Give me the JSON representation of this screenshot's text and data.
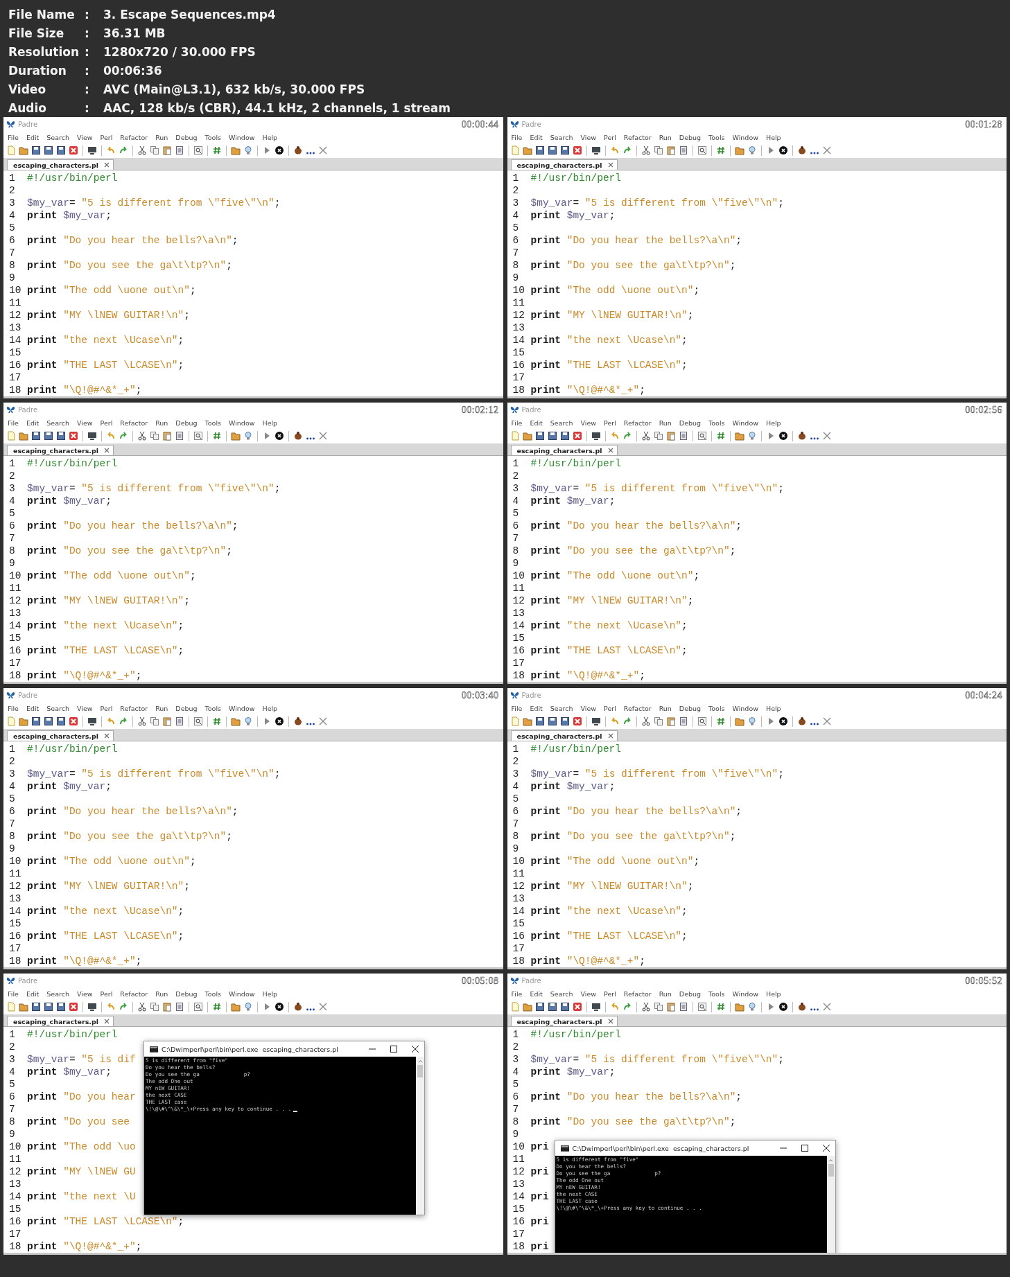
{
  "info": [
    {
      "label": "File Name",
      "value": "3. Escape Sequences.mp4"
    },
    {
      "label": "File Size",
      "value": "36.31 MB"
    },
    {
      "label": "Resolution",
      "value": "1280x720 / 30.000 FPS"
    },
    {
      "label": "Duration",
      "value": "00:06:36"
    },
    {
      "label": "Video",
      "value": "AVC (Main@L3.1), 632 kb/s, 30.000 FPS"
    },
    {
      "label": "Audio",
      "value": "AAC, 128 kb/s (CBR), 44.1 kHz, 2 channels, 1 stream"
    }
  ],
  "info_separator": ":",
  "frames": [
    {
      "app_title": "Padre",
      "time": "00:00:44",
      "menu": [
        "File",
        "Edit",
        "Search",
        "View",
        "Perl",
        "Refactor",
        "Run",
        "Debug",
        "Tools",
        "Window",
        "Help"
      ],
      "tab": "escaping_characters.pl",
      "lines": [
        {
          "n": "1",
          "tokens": [
            {
              "kind": "shebang",
              "text": "#!/usr/bin/perl"
            }
          ]
        },
        {
          "n": "2"
        },
        {
          "n": "3",
          "tokens": [
            {
              "kind": "variable",
              "text": "$my_var"
            },
            {
              "kind": "plain",
              "text": "= "
            },
            {
              "kind": "string",
              "text": "\"5 is different from \\\"five\\\"\\n\""
            },
            {
              "kind": "plain",
              "text": ";"
            }
          ]
        },
        {
          "n": "4",
          "tokens": [
            {
              "kind": "keyword",
              "text": "print "
            },
            {
              "kind": "variable",
              "text": "$my_var"
            },
            {
              "kind": "plain",
              "text": ";"
            }
          ]
        },
        {
          "n": "5"
        },
        {
          "n": "6",
          "tokens": [
            {
              "kind": "keyword",
              "text": "print "
            },
            {
              "kind": "string",
              "text": "\"Do you hear the bells?\\a\\n\""
            },
            {
              "kind": "plain",
              "text": ";"
            }
          ]
        },
        {
          "n": "7"
        },
        {
          "n": "8",
          "tokens": [
            {
              "kind": "keyword",
              "text": "print "
            },
            {
              "kind": "string",
              "text": "\"Do you see the ga\\t\\tp?\\n\""
            },
            {
              "kind": "plain",
              "text": ";"
            }
          ]
        },
        {
          "n": "9"
        },
        {
          "n": "10",
          "tokens": [
            {
              "kind": "keyword",
              "text": "print "
            },
            {
              "kind": "string",
              "text": "\"The odd \\uone out\\n\""
            },
            {
              "kind": "plain",
              "text": ";"
            }
          ]
        },
        {
          "n": "11"
        },
        {
          "n": "12",
          "tokens": [
            {
              "kind": "keyword",
              "text": "print "
            },
            {
              "kind": "string",
              "text": "\"MY \\lNEW GUITAR!\\n\""
            },
            {
              "kind": "plain",
              "text": ";"
            }
          ]
        },
        {
          "n": "13"
        },
        {
          "n": "14",
          "tokens": [
            {
              "kind": "keyword",
              "text": "print "
            },
            {
              "kind": "string",
              "text": "\"the next \\Ucase\\n\""
            },
            {
              "kind": "plain",
              "text": ";"
            }
          ]
        },
        {
          "n": "15"
        },
        {
          "n": "16",
          "tokens": [
            {
              "kind": "keyword",
              "text": "print "
            },
            {
              "kind": "string",
              "text": "\"THE LAST \\LCASE\\n\""
            },
            {
              "kind": "plain",
              "text": ";"
            }
          ]
        },
        {
          "n": "17"
        },
        {
          "n": "18",
          "tokens": [
            {
              "kind": "keyword",
              "text": "print "
            },
            {
              "kind": "string",
              "text": "\"\\Q!@#^&*_+\""
            },
            {
              "kind": "plain",
              "text": ";"
            }
          ]
        }
      ]
    },
    {
      "app_title": "Padre",
      "time": "00:01:28",
      "menu": [
        "File",
        "Edit",
        "Search",
        "View",
        "Perl",
        "Refactor",
        "Run",
        "Debug",
        "Tools",
        "Window",
        "Help"
      ],
      "tab": "escaping_characters.pl",
      "lines": [
        {
          "n": "1",
          "tokens": [
            {
              "kind": "shebang",
              "text": "#!/usr/bin/perl"
            }
          ]
        },
        {
          "n": "2"
        },
        {
          "n": "3",
          "tokens": [
            {
              "kind": "variable",
              "text": "$my_var"
            },
            {
              "kind": "plain",
              "text": "= "
            },
            {
              "kind": "string",
              "text": "\"5 is different from \\\"five\\\"\\n\""
            },
            {
              "kind": "plain",
              "text": ";"
            }
          ]
        },
        {
          "n": "4",
          "tokens": [
            {
              "kind": "keyword",
              "text": "print "
            },
            {
              "kind": "variable",
              "text": "$my_var"
            },
            {
              "kind": "plain",
              "text": ";"
            }
          ]
        },
        {
          "n": "5"
        },
        {
          "n": "6",
          "tokens": [
            {
              "kind": "keyword",
              "text": "print "
            },
            {
              "kind": "string",
              "text": "\"Do you hear the bells?\\a\\n\""
            },
            {
              "kind": "plain",
              "text": ";"
            }
          ]
        },
        {
          "n": "7"
        },
        {
          "n": "8",
          "tokens": [
            {
              "kind": "keyword",
              "text": "print "
            },
            {
              "kind": "string",
              "text": "\"Do you see the ga\\t\\tp?\\n\""
            },
            {
              "kind": "plain",
              "text": ";"
            }
          ]
        },
        {
          "n": "9"
        },
        {
          "n": "10",
          "tokens": [
            {
              "kind": "keyword",
              "text": "print "
            },
            {
              "kind": "string",
              "text": "\"The odd \\uone out\\n\""
            },
            {
              "kind": "plain",
              "text": ";"
            }
          ]
        },
        {
          "n": "11"
        },
        {
          "n": "12",
          "tokens": [
            {
              "kind": "keyword",
              "text": "print "
            },
            {
              "kind": "string",
              "text": "\"MY \\lNEW GUITAR!\\n\""
            },
            {
              "kind": "plain",
              "text": ";"
            }
          ]
        },
        {
          "n": "13"
        },
        {
          "n": "14",
          "tokens": [
            {
              "kind": "keyword",
              "text": "print "
            },
            {
              "kind": "string",
              "text": "\"the next \\Ucase\\n\""
            },
            {
              "kind": "plain",
              "text": ";"
            }
          ]
        },
        {
          "n": "15"
        },
        {
          "n": "16",
          "tokens": [
            {
              "kind": "keyword",
              "text": "print "
            },
            {
              "kind": "string",
              "text": "\"THE LAST \\LCASE\\n\""
            },
            {
              "kind": "plain",
              "text": ";"
            }
          ]
        },
        {
          "n": "17"
        },
        {
          "n": "18",
          "tokens": [
            {
              "kind": "keyword",
              "text": "print "
            },
            {
              "kind": "string",
              "text": "\"\\Q!@#^&*_+\""
            },
            {
              "kind": "plain",
              "text": ";"
            }
          ]
        }
      ]
    },
    {
      "app_title": "Padre",
      "time": "00:02:12",
      "menu": [
        "File",
        "Edit",
        "Search",
        "View",
        "Perl",
        "Refactor",
        "Run",
        "Debug",
        "Tools",
        "Window",
        "Help"
      ],
      "tab": "escaping_characters.pl",
      "lines": [
        {
          "n": "1",
          "tokens": [
            {
              "kind": "shebang",
              "text": "#!/usr/bin/perl"
            }
          ]
        },
        {
          "n": "2"
        },
        {
          "n": "3",
          "tokens": [
            {
              "kind": "variable",
              "text": "$my_var"
            },
            {
              "kind": "plain",
              "text": "= "
            },
            {
              "kind": "string",
              "text": "\"5 is different from \\\"five\\\"\\n\""
            },
            {
              "kind": "plain",
              "text": ";"
            }
          ]
        },
        {
          "n": "4",
          "tokens": [
            {
              "kind": "keyword",
              "text": "print "
            },
            {
              "kind": "variable",
              "text": "$my_var"
            },
            {
              "kind": "plain",
              "text": ";"
            }
          ]
        },
        {
          "n": "5"
        },
        {
          "n": "6",
          "tokens": [
            {
              "kind": "keyword",
              "text": "print "
            },
            {
              "kind": "string",
              "text": "\"Do you hear the bells?\\a\\n\""
            },
            {
              "kind": "plain",
              "text": ";"
            }
          ]
        },
        {
          "n": "7"
        },
        {
          "n": "8",
          "tokens": [
            {
              "kind": "keyword",
              "text": "print "
            },
            {
              "kind": "string",
              "text": "\"Do you see the ga\\t\\tp?\\n\""
            },
            {
              "kind": "plain",
              "text": ";"
            }
          ]
        },
        {
          "n": "9"
        },
        {
          "n": "10",
          "tokens": [
            {
              "kind": "keyword",
              "text": "print "
            },
            {
              "kind": "string",
              "text": "\"The odd \\uone out\\n\""
            },
            {
              "kind": "plain",
              "text": ";"
            }
          ]
        },
        {
          "n": "11"
        },
        {
          "n": "12",
          "tokens": [
            {
              "kind": "keyword",
              "text": "print "
            },
            {
              "kind": "string",
              "text": "\"MY \\lNEW GUITAR!\\n\""
            },
            {
              "kind": "plain",
              "text": ";"
            }
          ]
        },
        {
          "n": "13"
        },
        {
          "n": "14",
          "tokens": [
            {
              "kind": "keyword",
              "text": "print "
            },
            {
              "kind": "string",
              "text": "\"the next \\Ucase\\n\""
            },
            {
              "kind": "plain",
              "text": ";"
            }
          ]
        },
        {
          "n": "15"
        },
        {
          "n": "16",
          "tokens": [
            {
              "kind": "keyword",
              "text": "print "
            },
            {
              "kind": "string",
              "text": "\"THE LAST \\LCASE\\n\""
            },
            {
              "kind": "plain",
              "text": ";"
            }
          ]
        },
        {
          "n": "17"
        },
        {
          "n": "18",
          "tokens": [
            {
              "kind": "keyword",
              "text": "print "
            },
            {
              "kind": "string",
              "text": "\"\\Q!@#^&*_+\""
            },
            {
              "kind": "plain",
              "text": ";"
            }
          ]
        }
      ]
    },
    {
      "app_title": "Padre",
      "time": "00:02:56",
      "menu": [
        "File",
        "Edit",
        "Search",
        "View",
        "Perl",
        "Refactor",
        "Run",
        "Debug",
        "Tools",
        "Window",
        "Help"
      ],
      "tab": "escaping_characters.pl",
      "lines": [
        {
          "n": "1",
          "tokens": [
            {
              "kind": "shebang",
              "text": "#!/usr/bin/perl"
            }
          ]
        },
        {
          "n": "2"
        },
        {
          "n": "3",
          "tokens": [
            {
              "kind": "variable",
              "text": "$my_var"
            },
            {
              "kind": "plain",
              "text": "= "
            },
            {
              "kind": "string",
              "text": "\"5 is different from \\\"five\\\"\\n\""
            },
            {
              "kind": "plain",
              "text": ";"
            }
          ]
        },
        {
          "n": "4",
          "tokens": [
            {
              "kind": "keyword",
              "text": "print "
            },
            {
              "kind": "variable",
              "text": "$my_var"
            },
            {
              "kind": "plain",
              "text": ";"
            }
          ]
        },
        {
          "n": "5"
        },
        {
          "n": "6",
          "tokens": [
            {
              "kind": "keyword",
              "text": "print "
            },
            {
              "kind": "string",
              "text": "\"Do you hear the bells?\\a\\n\""
            },
            {
              "kind": "plain",
              "text": ";"
            }
          ]
        },
        {
          "n": "7"
        },
        {
          "n": "8",
          "tokens": [
            {
              "kind": "keyword",
              "text": "print "
            },
            {
              "kind": "string",
              "text": "\"Do you see the ga\\t\\tp?\\n\""
            },
            {
              "kind": "plain",
              "text": ";"
            }
          ]
        },
        {
          "n": "9"
        },
        {
          "n": "10",
          "tokens": [
            {
              "kind": "keyword",
              "text": "print "
            },
            {
              "kind": "string",
              "text": "\"The odd \\uone out\\n\""
            },
            {
              "kind": "plain",
              "text": ";"
            }
          ]
        },
        {
          "n": "11"
        },
        {
          "n": "12",
          "tokens": [
            {
              "kind": "keyword",
              "text": "print "
            },
            {
              "kind": "string",
              "text": "\"MY \\lNEW GUITAR!\\n\""
            },
            {
              "kind": "plain",
              "text": ";"
            }
          ]
        },
        {
          "n": "13"
        },
        {
          "n": "14",
          "tokens": [
            {
              "kind": "keyword",
              "text": "print "
            },
            {
              "kind": "string",
              "text": "\"the next \\Ucase\\n\""
            },
            {
              "kind": "plain",
              "text": ";"
            }
          ]
        },
        {
          "n": "15"
        },
        {
          "n": "16",
          "tokens": [
            {
              "kind": "keyword",
              "text": "print "
            },
            {
              "kind": "string",
              "text": "\"THE LAST \\LCASE\\n\""
            },
            {
              "kind": "plain",
              "text": ";"
            }
          ]
        },
        {
          "n": "17"
        },
        {
          "n": "18",
          "tokens": [
            {
              "kind": "keyword",
              "text": "print "
            },
            {
              "kind": "string",
              "text": "\"\\Q!@#^&*_+\""
            },
            {
              "kind": "plain",
              "text": ";"
            }
          ]
        }
      ]
    },
    {
      "app_title": "Padre",
      "time": "00:03:40",
      "menu": [
        "File",
        "Edit",
        "Search",
        "View",
        "Perl",
        "Refactor",
        "Run",
        "Debug",
        "Tools",
        "Window",
        "Help"
      ],
      "tab": "escaping_characters.pl",
      "lines": [
        {
          "n": "1",
          "tokens": [
            {
              "kind": "shebang",
              "text": "#!/usr/bin/perl"
            }
          ]
        },
        {
          "n": "2"
        },
        {
          "n": "3",
          "tokens": [
            {
              "kind": "variable",
              "text": "$my_var"
            },
            {
              "kind": "plain",
              "text": "= "
            },
            {
              "kind": "string",
              "text": "\"5 is different from \\\"five\\\"\\n\""
            },
            {
              "kind": "plain",
              "text": ";"
            }
          ]
        },
        {
          "n": "4",
          "tokens": [
            {
              "kind": "keyword",
              "text": "print "
            },
            {
              "kind": "variable",
              "text": "$my_var"
            },
            {
              "kind": "plain",
              "text": ";"
            }
          ]
        },
        {
          "n": "5"
        },
        {
          "n": "6",
          "tokens": [
            {
              "kind": "keyword",
              "text": "print "
            },
            {
              "kind": "string",
              "text": "\"Do you hear the bells?\\a\\n\""
            },
            {
              "kind": "plain",
              "text": ";"
            }
          ]
        },
        {
          "n": "7"
        },
        {
          "n": "8",
          "tokens": [
            {
              "kind": "keyword",
              "text": "print "
            },
            {
              "kind": "string",
              "text": "\"Do you see the ga\\t\\tp?\\n\""
            },
            {
              "kind": "plain",
              "text": ";"
            }
          ]
        },
        {
          "n": "9"
        },
        {
          "n": "10",
          "tokens": [
            {
              "kind": "keyword",
              "text": "print "
            },
            {
              "kind": "string",
              "text": "\"The odd \\uone out\\n\""
            },
            {
              "kind": "plain",
              "text": ";"
            }
          ]
        },
        {
          "n": "11"
        },
        {
          "n": "12",
          "tokens": [
            {
              "kind": "keyword",
              "text": "print "
            },
            {
              "kind": "string",
              "text": "\"MY \\lNEW GUITAR!\\n\""
            },
            {
              "kind": "plain",
              "text": ";"
            }
          ]
        },
        {
          "n": "13"
        },
        {
          "n": "14",
          "tokens": [
            {
              "kind": "keyword",
              "text": "print "
            },
            {
              "kind": "string",
              "text": "\"the next \\Ucase\\n\""
            },
            {
              "kind": "plain",
              "text": ";"
            }
          ]
        },
        {
          "n": "15"
        },
        {
          "n": "16",
          "tokens": [
            {
              "kind": "keyword",
              "text": "print "
            },
            {
              "kind": "string",
              "text": "\"THE LAST \\LCASE\\n\""
            },
            {
              "kind": "plain",
              "text": ";"
            }
          ]
        },
        {
          "n": "17"
        },
        {
          "n": "18",
          "tokens": [
            {
              "kind": "keyword",
              "text": "print "
            },
            {
              "kind": "string",
              "text": "\"\\Q!@#^&*_+\""
            },
            {
              "kind": "plain",
              "text": ";"
            }
          ]
        }
      ]
    },
    {
      "app_title": "Padre",
      "time": "00:04:24",
      "menu": [
        "File",
        "Edit",
        "Search",
        "View",
        "Perl",
        "Refactor",
        "Run",
        "Debug",
        "Tools",
        "Window",
        "Help"
      ],
      "tab": "escaping_characters.pl",
      "lines": [
        {
          "n": "1",
          "tokens": [
            {
              "kind": "shebang",
              "text": "#!/usr/bin/perl"
            }
          ]
        },
        {
          "n": "2"
        },
        {
          "n": "3",
          "tokens": [
            {
              "kind": "variable",
              "text": "$my_var"
            },
            {
              "kind": "plain",
              "text": "= "
            },
            {
              "kind": "string",
              "text": "\"5 is different from \\\"five\\\"\\n\""
            },
            {
              "kind": "plain",
              "text": ";"
            }
          ]
        },
        {
          "n": "4",
          "tokens": [
            {
              "kind": "keyword",
              "text": "print "
            },
            {
              "kind": "variable",
              "text": "$my_var"
            },
            {
              "kind": "plain",
              "text": ";"
            }
          ]
        },
        {
          "n": "5"
        },
        {
          "n": "6",
          "tokens": [
            {
              "kind": "keyword",
              "text": "print "
            },
            {
              "kind": "string",
              "text": "\"Do you hear the bells?\\a\\n\""
            },
            {
              "kind": "plain",
              "text": ";"
            }
          ]
        },
        {
          "n": "7"
        },
        {
          "n": "8",
          "tokens": [
            {
              "kind": "keyword",
              "text": "print "
            },
            {
              "kind": "string",
              "text": "\"Do you see the ga\\t\\tp?\\n\""
            },
            {
              "kind": "plain",
              "text": ";"
            }
          ]
        },
        {
          "n": "9"
        },
        {
          "n": "10",
          "tokens": [
            {
              "kind": "keyword",
              "text": "print "
            },
            {
              "kind": "string",
              "text": "\"The odd \\uone out\\n\""
            },
            {
              "kind": "plain",
              "text": ";"
            }
          ]
        },
        {
          "n": "11"
        },
        {
          "n": "12",
          "tokens": [
            {
              "kind": "keyword",
              "text": "print "
            },
            {
              "kind": "string",
              "text": "\"MY \\lNEW GUITAR!\\n\""
            },
            {
              "kind": "plain",
              "text": ";"
            }
          ]
        },
        {
          "n": "13"
        },
        {
          "n": "14",
          "tokens": [
            {
              "kind": "keyword",
              "text": "print "
            },
            {
              "kind": "string",
              "text": "\"the next \\Ucase\\n\""
            },
            {
              "kind": "plain",
              "text": ";"
            }
          ]
        },
        {
          "n": "15"
        },
        {
          "n": "16",
          "tokens": [
            {
              "kind": "keyword",
              "text": "print "
            },
            {
              "kind": "string",
              "text": "\"THE LAST \\LCASE\\n\""
            },
            {
              "kind": "plain",
              "text": ";"
            }
          ]
        },
        {
          "n": "17"
        },
        {
          "n": "18",
          "tokens": [
            {
              "kind": "keyword",
              "text": "print "
            },
            {
              "kind": "string",
              "text": "\"\\Q!@#^&*_+\""
            },
            {
              "kind": "plain",
              "text": ";"
            }
          ]
        }
      ]
    },
    {
      "app_title": "Padre",
      "time": "00:05:08",
      "menu": [
        "File",
        "Edit",
        "Search",
        "View",
        "Perl",
        "Refactor",
        "Run",
        "Debug",
        "Tools",
        "Window",
        "Help"
      ],
      "tab": "escaping_characters.pl",
      "lines": [
        {
          "n": "1",
          "tokens": [
            {
              "kind": "shebang",
              "text": "#!/usr/bin/perl"
            }
          ]
        },
        {
          "n": "2"
        },
        {
          "n": "3",
          "tokens": [
            {
              "kind": "variable",
              "text": "$my_var"
            },
            {
              "kind": "plain",
              "text": "= "
            },
            {
              "kind": "string",
              "text": "\"5 is dif"
            }
          ]
        },
        {
          "n": "4",
          "tokens": [
            {
              "kind": "keyword",
              "text": "print "
            },
            {
              "kind": "variable",
              "text": "$my_var"
            },
            {
              "kind": "plain",
              "text": ";"
            }
          ]
        },
        {
          "n": "5"
        },
        {
          "n": "6",
          "tokens": [
            {
              "kind": "keyword",
              "text": "print "
            },
            {
              "kind": "string",
              "text": "\"Do you hear"
            }
          ]
        },
        {
          "n": "7"
        },
        {
          "n": "8",
          "tokens": [
            {
              "kind": "keyword",
              "text": "print "
            },
            {
              "kind": "string",
              "text": "\"Do you see"
            }
          ]
        },
        {
          "n": "9"
        },
        {
          "n": "10",
          "tokens": [
            {
              "kind": "keyword",
              "text": "print "
            },
            {
              "kind": "string",
              "text": "\"The odd \\uo"
            }
          ]
        },
        {
          "n": "11"
        },
        {
          "n": "12",
          "tokens": [
            {
              "kind": "keyword",
              "text": "print "
            },
            {
              "kind": "string",
              "text": "\"MY \\lNEW GU"
            }
          ]
        },
        {
          "n": "13"
        },
        {
          "n": "14",
          "tokens": [
            {
              "kind": "keyword",
              "text": "print "
            },
            {
              "kind": "string",
              "text": "\"the next \\U"
            }
          ]
        },
        {
          "n": "15"
        },
        {
          "n": "16",
          "tokens": [
            {
              "kind": "keyword",
              "text": "print "
            },
            {
              "kind": "string",
              "text": "\"THE LAST \\LCASE\\n\""
            },
            {
              "kind": "plain",
              "text": ";"
            }
          ]
        },
        {
          "n": "17"
        },
        {
          "n": "18",
          "tokens": [
            {
              "kind": "keyword",
              "text": "print "
            },
            {
              "kind": "string",
              "text": "\"\\Q!@#^&*_+\""
            },
            {
              "kind": "plain",
              "text": ";"
            }
          ]
        }
      ],
      "console": {
        "title": "C:\\Dwimperl\\perl\\bin\\perl.exe  escaping_characters.pl",
        "cursor_visible": true,
        "output": [
          "5 is different from \"five\"",
          "Do you hear the bells?",
          "Do you see the ga              p?",
          "The odd One out",
          "MY nEW GUITAR!",
          "the next CASE",
          "THE LAST case",
          "\\!\\@\\#\\^\\&\\*_\\+Press any key to continue . . ."
        ]
      }
    },
    {
      "app_title": "Padre",
      "time": "00:05:52",
      "menu": [
        "File",
        "Edit",
        "Search",
        "View",
        "Perl",
        "Refactor",
        "Run",
        "Debug",
        "Tools",
        "Window",
        "Help"
      ],
      "tab": "escaping_characters.pl",
      "lines": [
        {
          "n": "1",
          "tokens": [
            {
              "kind": "shebang",
              "text": "#!/usr/bin/perl"
            }
          ]
        },
        {
          "n": "2"
        },
        {
          "n": "3",
          "tokens": [
            {
              "kind": "variable",
              "text": "$my_var"
            },
            {
              "kind": "plain",
              "text": "= "
            },
            {
              "kind": "string",
              "text": "\"5 is different from \\\"five\\\"\\n\""
            },
            {
              "kind": "plain",
              "text": ";"
            }
          ]
        },
        {
          "n": "4",
          "tokens": [
            {
              "kind": "keyword",
              "text": "print "
            },
            {
              "kind": "variable",
              "text": "$my_var"
            },
            {
              "kind": "plain",
              "text": ";"
            }
          ]
        },
        {
          "n": "5"
        },
        {
          "n": "6",
          "tokens": [
            {
              "kind": "keyword",
              "text": "print "
            },
            {
              "kind": "string",
              "text": "\"Do you hear the bells?\\a\\n\""
            },
            {
              "kind": "plain",
              "text": ";"
            }
          ]
        },
        {
          "n": "7"
        },
        {
          "n": "8",
          "tokens": [
            {
              "kind": "keyword",
              "text": "print "
            },
            {
              "kind": "string",
              "text": "\"Do you see the ga\\t\\tp?\\n\""
            },
            {
              "kind": "plain",
              "text": ";"
            }
          ]
        },
        {
          "n": "9"
        },
        {
          "n": "10",
          "tokens": [
            {
              "kind": "keyword",
              "text": "pri"
            }
          ]
        },
        {
          "n": "11"
        },
        {
          "n": "12",
          "tokens": [
            {
              "kind": "keyword",
              "text": "pri"
            }
          ]
        },
        {
          "n": "13"
        },
        {
          "n": "14",
          "tokens": [
            {
              "kind": "keyword",
              "text": "pri"
            }
          ]
        },
        {
          "n": "15"
        },
        {
          "n": "16",
          "tokens": [
            {
              "kind": "keyword",
              "text": "pri"
            }
          ]
        },
        {
          "n": "17"
        },
        {
          "n": "18",
          "tokens": [
            {
              "kind": "keyword",
              "text": "pri"
            }
          ]
        }
      ],
      "console": {
        "title": "C:\\Dwimperl\\perl\\bin\\perl.exe  escaping_characters.pl",
        "cursor_visible": false,
        "output": [
          "5 is different from \"five\"",
          "Do you hear the bells?",
          "Do you see the ga              p?",
          "The odd One out",
          "MY nEW GUITAR!",
          "the next CASE",
          "THE LAST case",
          "\\!\\@\\#\\^\\&\\*_\\+Press any key to continue . . ."
        ]
      }
    }
  ]
}
